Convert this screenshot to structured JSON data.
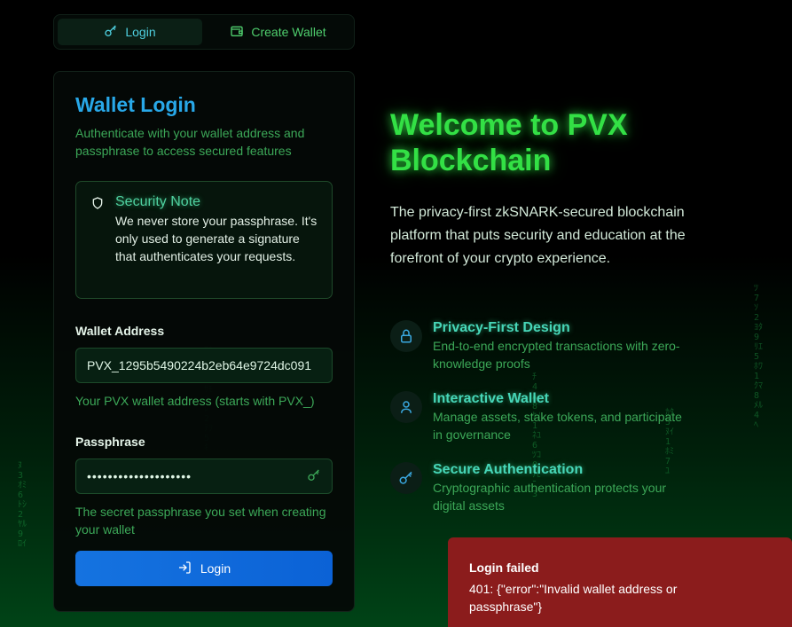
{
  "tabs": [
    {
      "label": "Login",
      "icon": "key-icon",
      "active": true
    },
    {
      "label": "Create Wallet",
      "icon": "wallet-icon",
      "active": false
    }
  ],
  "login_card": {
    "title": "Wallet Login",
    "subtitle": "Authenticate with your wallet address and passphrase to access secured features",
    "security_note": {
      "title": "Security Note",
      "text": "We never store your passphrase. It's only used to generate a signature that authenticates your requests."
    },
    "address": {
      "label": "Wallet Address",
      "value": "PVX_1295b5490224b2eb64e9724dc091",
      "hint": "Your PVX wallet address (starts with PVX_)"
    },
    "passphrase": {
      "label": "Passphrase",
      "masked_value": "••••••••••••••••••••",
      "hint": "The secret passphrase you set when creating your wallet"
    },
    "login_button": "Login"
  },
  "hero": {
    "title": "Welcome to PVX Blockchain",
    "description": "The privacy-first zkSNARK-secured blockchain platform that puts security and education at the forefront of your crypto experience."
  },
  "features": [
    {
      "title": "Privacy-First Design",
      "text": "End-to-end encrypted transactions with zero-knowledge proofs",
      "icon": "lock-icon"
    },
    {
      "title": "Interactive Wallet",
      "text": "Manage assets, stake tokens, and participate in governance",
      "icon": "user-icon"
    },
    {
      "title": "Secure Authentication",
      "text": "Cryptographic authentication protects your digital assets",
      "icon": "key-icon"
    }
  ],
  "toast": {
    "title": "Login failed",
    "message": "401: {\"error\":\"Invalid wallet address or passphrase\"}"
  },
  "colors": {
    "accent_blue": "#28a8e8",
    "accent_green": "#33e045",
    "button_blue": "#1573e0",
    "error_red": "#8b1c1c"
  }
}
